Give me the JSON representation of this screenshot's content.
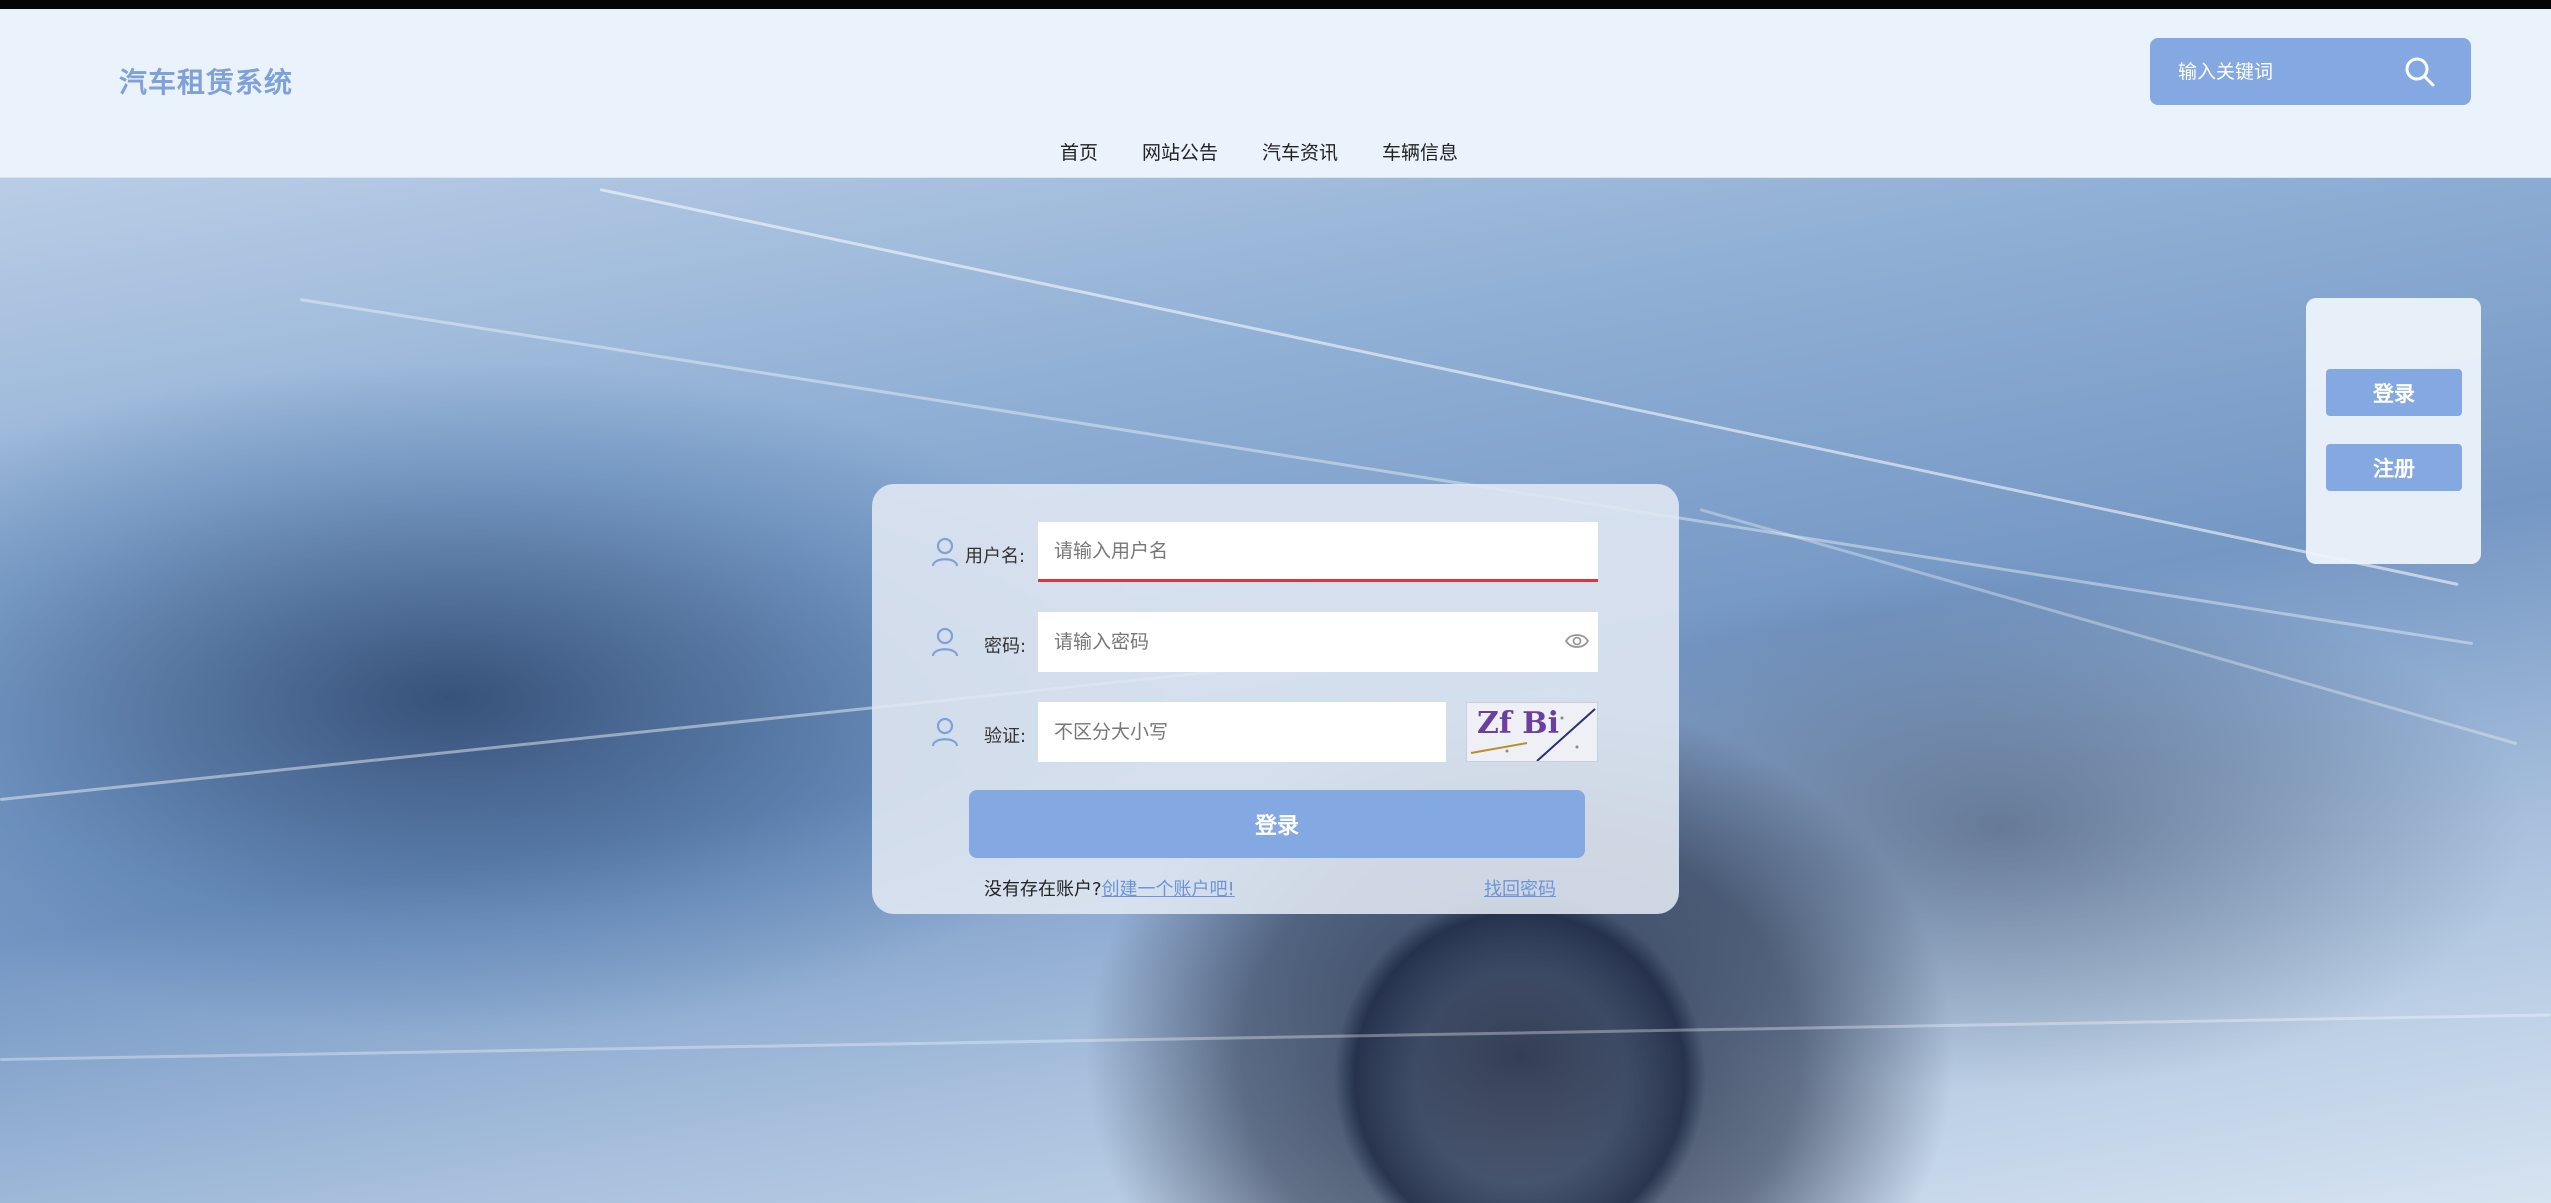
{
  "header": {
    "site_title": "汽车租赁系统",
    "search_placeholder": "输入关键词"
  },
  "nav": {
    "items": [
      {
        "label": "首页"
      },
      {
        "label": "网站公告"
      },
      {
        "label": "汽车资讯"
      },
      {
        "label": "车辆信息"
      }
    ]
  },
  "side_panel": {
    "login_label": "登录",
    "register_label": "注册"
  },
  "login_form": {
    "username_label": "用户名:",
    "username_placeholder": "请输入用户名",
    "password_label": "密码:",
    "password_placeholder": "请输入密码",
    "captcha_label": "验证:",
    "captcha_placeholder": "不区分大小写",
    "captcha_text": "Zf Bi",
    "submit_label": "登录",
    "no_account_text": "没有存在账户?",
    "create_account_link": "创建一个账户吧!",
    "forgot_password_link": "找回密码"
  },
  "colors": {
    "accent": "#84a8e2",
    "header_bg": "#eaf2fb",
    "title": "#7fa1d8",
    "link": "#6d95d6",
    "focus_underline": "#d9363e"
  }
}
